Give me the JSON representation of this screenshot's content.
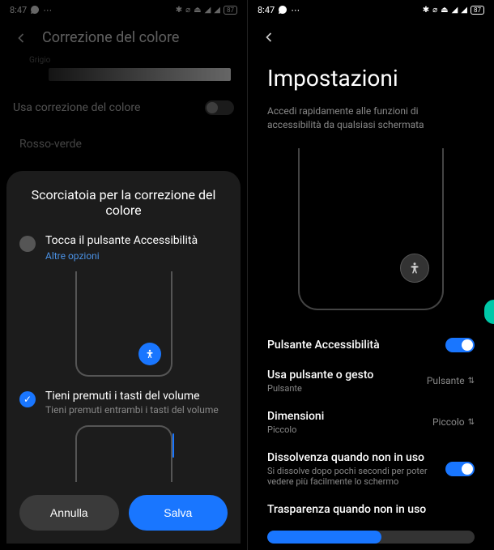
{
  "status": {
    "time": "8:47",
    "whatsapp_icon": "whatsapp",
    "more_icon": "⋯",
    "icons_right": "✱ ⌀ ⏚ ⚕ 📶",
    "battery": "87"
  },
  "left": {
    "header_title": "Correzione del colore",
    "gray_label": "Grigio",
    "use_correction": "Usa correzione del colore",
    "option_name": "Rosso-verde",
    "dialog": {
      "title": "Scorciatoia per la correzione del colore",
      "opt1_label": "Tocca il pulsante Accessibilità",
      "opt1_link": "Altre opzioni",
      "opt2_label": "Tieni premuti i tasti del volume",
      "opt2_sub": "Tieni premuti entrambi i tasti del volume",
      "cancel": "Annulla",
      "save": "Salva"
    }
  },
  "right": {
    "title": "Impostazioni",
    "subtitle": "Accedi rapidamente alle funzioni di accessibilità da qualsiasi schermata",
    "item1": "Pulsante Accessibilità",
    "item2_title": "Usa pulsante o gesto",
    "item2_sub": "Pulsante",
    "item2_value": "Pulsante",
    "item3_title": "Dimensioni",
    "item3_sub": "Piccolo",
    "item3_value": "Piccolo",
    "item4_title": "Dissolvenza quando non in uso",
    "item4_sub": "Si dissolve dopo pochi secondi per poter vedere più facilmente lo schermo",
    "item5_title": "Trasparenza quando non in uso"
  }
}
